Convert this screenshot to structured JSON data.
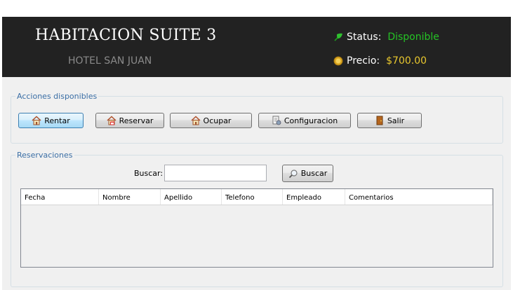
{
  "header": {
    "title": "HABITACION SUITE 3",
    "hotel": "HOTEL SAN JUAN",
    "status_label": "Status:",
    "status_value": "Disponible",
    "price_label": "Precio:",
    "price_value": "$700.00",
    "status_color": "#25c325",
    "price_color": "#e8c72e"
  },
  "actions": {
    "legend": "Acciones disponibles",
    "buttons": [
      {
        "label": "Rentar",
        "icon": "house-icon"
      },
      {
        "label": "Reservar",
        "icon": "house-calendar-icon"
      },
      {
        "label": "Ocupar",
        "icon": "house-icon"
      },
      {
        "label": "Configuracion",
        "icon": "document-settings-icon"
      },
      {
        "label": "Salir",
        "icon": "door-icon"
      }
    ]
  },
  "reservations": {
    "legend": "Reservaciones",
    "search_label": "Buscar:",
    "search_value": "",
    "search_button": "Buscar",
    "columns": [
      "Fecha",
      "Nombre",
      "Apellido",
      "Telefono",
      "Empleado",
      "Comentarios"
    ],
    "rows": []
  }
}
